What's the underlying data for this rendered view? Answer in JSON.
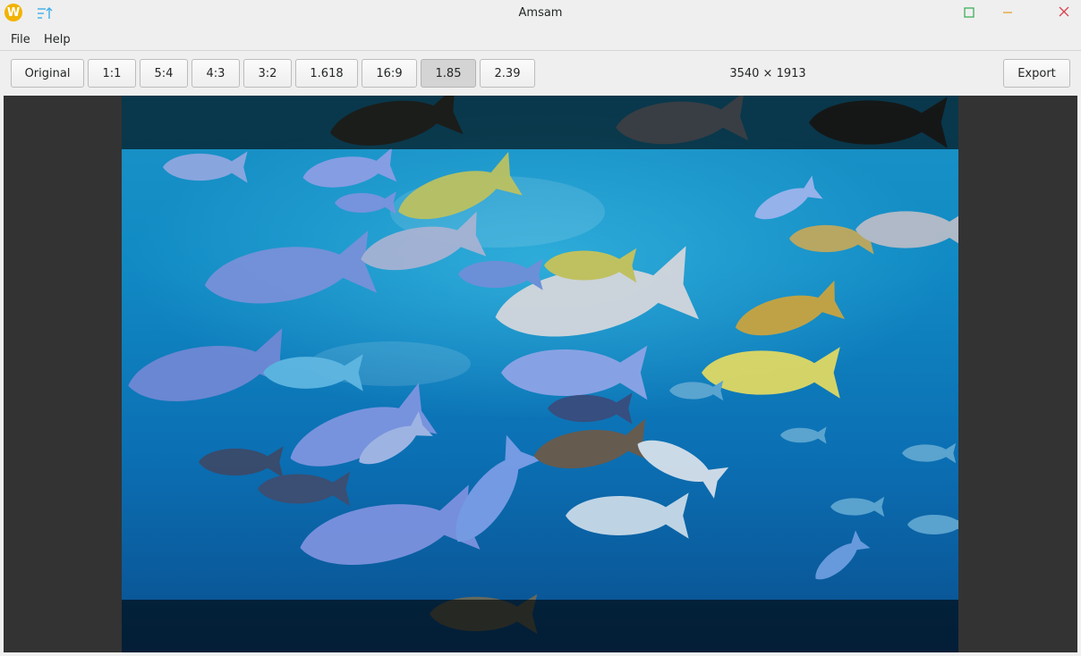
{
  "window": {
    "title": "Amsam",
    "app_icon_letter": "W"
  },
  "menu": {
    "file": "File",
    "help": "Help"
  },
  "toolbar": {
    "ratios": [
      {
        "label": "Original",
        "active": false
      },
      {
        "label": "1:1",
        "active": false
      },
      {
        "label": "5:4",
        "active": false
      },
      {
        "label": "4:3",
        "active": false
      },
      {
        "label": "3:2",
        "active": false
      },
      {
        "label": "1.618",
        "active": false
      },
      {
        "label": "16:9",
        "active": false
      },
      {
        "label": "1.85",
        "active": true
      },
      {
        "label": "2.39",
        "active": false
      }
    ],
    "dimensions": "3540 × 1913",
    "export_label": "Export"
  },
  "image": {
    "subject": "school of tropical fish underwater",
    "selected_ratio": "1.85"
  },
  "colors": {
    "app_icon": "#f2b300",
    "maximize": "#3daf5b",
    "minimize": "#e8a033",
    "close": "#da4453",
    "accent": "#3daee9"
  }
}
